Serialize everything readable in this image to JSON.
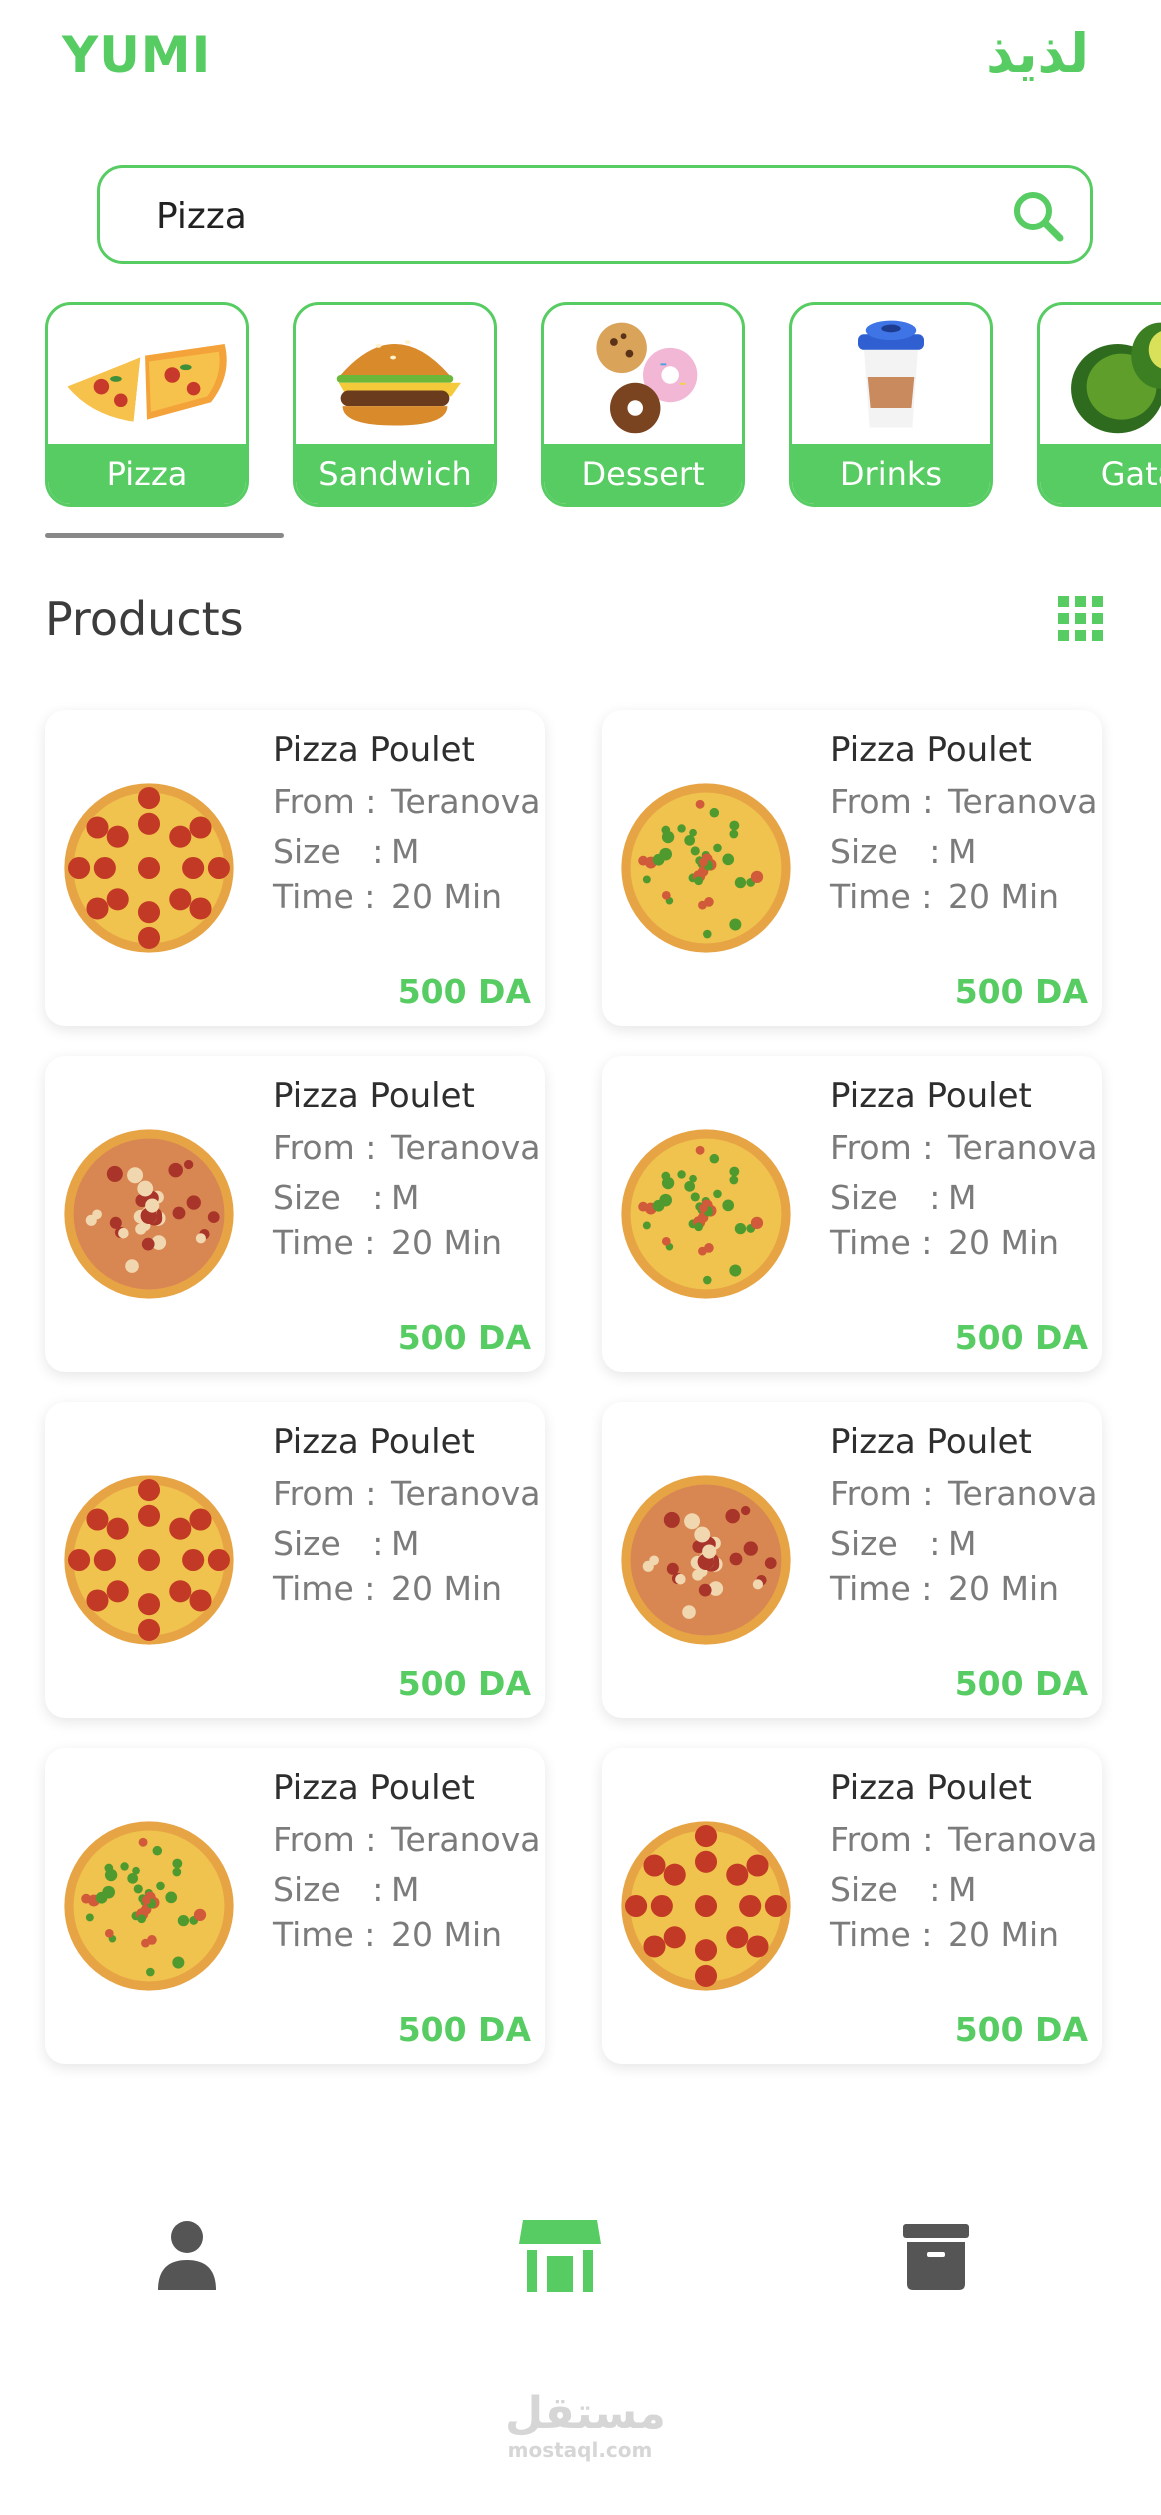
{
  "header": {
    "brand": "YUMI",
    "brand_arabic": "لذيذ"
  },
  "search": {
    "value": "Pizza",
    "placeholder": ""
  },
  "categories": [
    {
      "label": "Pizza",
      "icon": "pizza-slices-icon"
    },
    {
      "label": "Sandwich",
      "icon": "burger-icon"
    },
    {
      "label": "Dessert",
      "icon": "cookies-donut-icon"
    },
    {
      "label": "Drinks",
      "icon": "coffee-cup-icon"
    },
    {
      "label": "Gata",
      "icon": "avocado-icon"
    }
  ],
  "products_section": {
    "title": "Products"
  },
  "products": [
    {
      "name": "Pizza Poulet",
      "from_label": "From :",
      "from": "Teranova",
      "size_label": "Size   :",
      "size": "M",
      "time_label": "Time :",
      "time": "20 Min",
      "price": "500 DA",
      "image": "pepperoni-pizza"
    },
    {
      "name": "Pizza Poulet",
      "from_label": "From :",
      "from": "Teranova",
      "size_label": "Size   :",
      "size": "M",
      "time_label": "Time :",
      "time": "20 Min",
      "price": "500 DA",
      "image": "vegetable-pizza"
    },
    {
      "name": "Pizza Poulet",
      "from_label": "From :",
      "from": "Teranova",
      "size_label": "Size   :",
      "size": "M",
      "time_label": "Time :",
      "time": "20 Min",
      "price": "500 DA",
      "image": "meat-pizza"
    },
    {
      "name": "Pizza Poulet",
      "from_label": "From :",
      "from": "Teranova",
      "size_label": "Size   :",
      "size": "M",
      "time_label": "Time :",
      "time": "20 Min",
      "price": "500 DA",
      "image": "vegetable-pizza"
    },
    {
      "name": "Pizza Poulet",
      "from_label": "From :",
      "from": "Teranova",
      "size_label": "Size   :",
      "size": "M",
      "time_label": "Time :",
      "time": "20 Min",
      "price": "500 DA",
      "image": "pepperoni-pizza"
    },
    {
      "name": "Pizza Poulet",
      "from_label": "From :",
      "from": "Teranova",
      "size_label": "Size   :",
      "size": "M",
      "time_label": "Time :",
      "time": "20 Min",
      "price": "500 DA",
      "image": "meat-pizza"
    },
    {
      "name": "Pizza Poulet",
      "from_label": "From :",
      "from": "Teranova",
      "size_label": "Size   :",
      "size": "M",
      "time_label": "Time :",
      "time": "20 Min",
      "price": "500 DA",
      "image": "vegetable-pizza"
    },
    {
      "name": "Pizza Poulet",
      "from_label": "From :",
      "from": "Teranova",
      "size_label": "Size   :",
      "size": "M",
      "time_label": "Time :",
      "time": "20 Min",
      "price": "500 DA",
      "image": "pepperoni-pizza"
    }
  ],
  "bottom_nav": [
    {
      "icon": "user-icon",
      "active": false
    },
    {
      "icon": "store-icon",
      "active": true
    },
    {
      "icon": "archive-icon",
      "active": false
    }
  ],
  "watermark": {
    "arabic": "مستقل",
    "latin": "mostaql.com"
  },
  "colors": {
    "accent": "#56cc62",
    "text_dark": "#2e2e2e",
    "text_muted": "#7b7b7b",
    "nav_inactive": "#555555"
  }
}
